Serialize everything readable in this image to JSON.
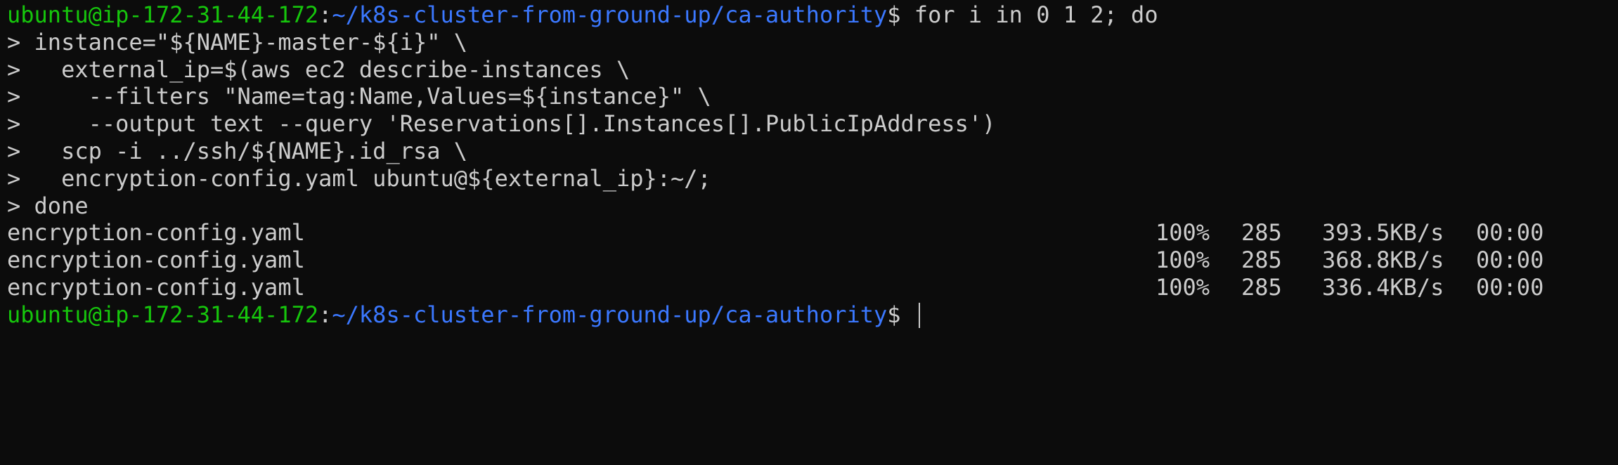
{
  "prompt": {
    "user_host": "ubuntu@ip-172-31-44-172",
    "sep": ":",
    "path": "~/k8s-cluster-from-ground-up/ca-authority",
    "symbol": "$ "
  },
  "command_lines": [
    "for i in 0 1 2; do",
    "> instance=\"${NAME}-master-${i}\" \\",
    ">   external_ip=$(aws ec2 describe-instances \\",
    ">     --filters \"Name=tag:Name,Values=${instance}\" \\",
    ">     --output text --query 'Reservations[].Instances[].PublicIpAddress')",
    ">   scp -i ../ssh/${NAME}.id_rsa \\",
    ">   encryption-config.yaml ubuntu@${external_ip}:~/;",
    "> done"
  ],
  "transfers": [
    {
      "file": "encryption-config.yaml",
      "percent": "100%",
      "size": "285",
      "rate": "393.5KB/s",
      "time": "00:00"
    },
    {
      "file": "encryption-config.yaml",
      "percent": "100%",
      "size": "285",
      "rate": "368.8KB/s",
      "time": "00:00"
    },
    {
      "file": "encryption-config.yaml",
      "percent": "100%",
      "size": "285",
      "rate": "336.4KB/s",
      "time": "00:00"
    }
  ],
  "colors": {
    "background": "#0c0c0c",
    "text": "#cccccc",
    "user_host": "#16c60c",
    "path": "#3b78ff"
  }
}
